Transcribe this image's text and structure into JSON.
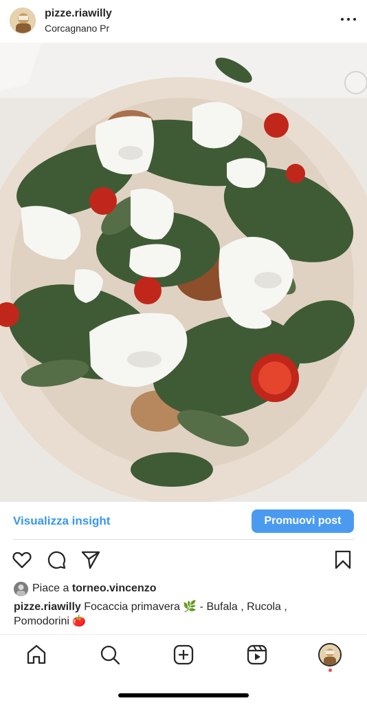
{
  "post": {
    "username": "pizze.riawilly",
    "location": "Corcagnano Pr",
    "avatar_icon": "profile-avatar",
    "more_icon": "more-horizontal-icon"
  },
  "photo": {
    "subject_icon": "pizza-photo"
  },
  "insight": {
    "link_label": "Visualizza insight",
    "promote_label": "Promuovi post",
    "accent_color": "#3897f0",
    "button_color": "#4a9bf0"
  },
  "actions": {
    "like_icon": "heart-icon",
    "comment_icon": "comment-icon",
    "share_icon": "send-icon",
    "save_icon": "bookmark-icon"
  },
  "likes": {
    "prefix": "Piace a ",
    "user": "torneo.vincenzo"
  },
  "caption": {
    "user": "pizze.riawilly",
    "text": " Focaccia primavera 🌿 - Bufala , Rucola , Pomodorini 🍅"
  },
  "bottom_nav": {
    "items": [
      "home-icon",
      "search-icon",
      "new-post-icon",
      "reels-icon",
      "profile-icon"
    ],
    "notification_color": "#ed4956"
  }
}
